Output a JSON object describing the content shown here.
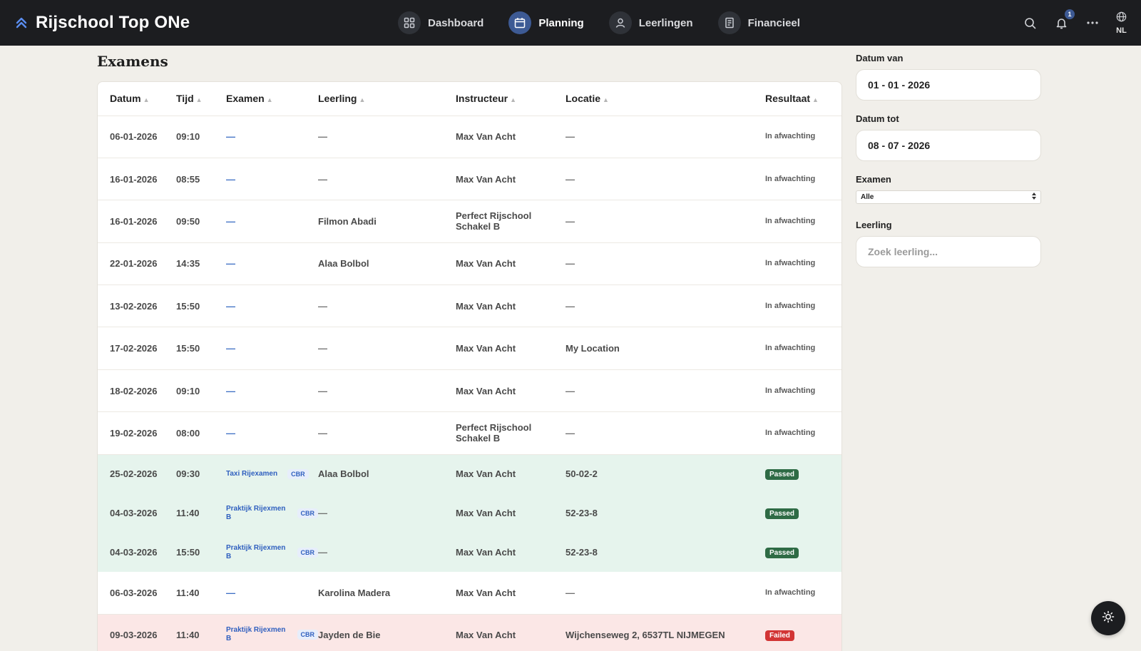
{
  "app": {
    "title": "Rijschool Top ONe",
    "logo_icon": "double-chevron-up-icon"
  },
  "nav": [
    {
      "label": "Dashboard",
      "icon": "grid-icon",
      "active": false
    },
    {
      "label": "Planning",
      "icon": "calendar-icon",
      "active": true
    },
    {
      "label": "Leerlingen",
      "icon": "user-icon",
      "active": false
    },
    {
      "label": "Financieel",
      "icon": "document-icon",
      "active": false
    }
  ],
  "topbar": {
    "notification_count": "1",
    "language": "NL"
  },
  "page": {
    "title": "Examens"
  },
  "table": {
    "headers": [
      "Datum",
      "Tijd",
      "Examen",
      "Leerling",
      "Instructeur",
      "Locatie",
      "Resultaat"
    ],
    "rows": [
      {
        "datum": "06-01-2026",
        "tijd": "09:10",
        "examen": "—",
        "leerling": "—",
        "instructeur": "Max Van Acht",
        "locatie": "—",
        "resultaat": "In afwachting",
        "status": "pending"
      },
      {
        "datum": "16-01-2026",
        "tijd": "08:55",
        "examen": "—",
        "leerling": "—",
        "instructeur": "Max Van Acht",
        "locatie": "—",
        "resultaat": "In afwachting",
        "status": "pending"
      },
      {
        "datum": "16-01-2026",
        "tijd": "09:50",
        "examen": "—",
        "leerling": "Filmon Abadi",
        "instructeur": "Perfect Rijschool Schakel B",
        "locatie": "—",
        "resultaat": "In afwachting",
        "status": "pending"
      },
      {
        "datum": "22-01-2026",
        "tijd": "14:35",
        "examen": "—",
        "leerling": "Alaa Bolbol",
        "instructeur": "Max Van Acht",
        "locatie": "—",
        "resultaat": "In afwachting",
        "status": "pending"
      },
      {
        "datum": "13-02-2026",
        "tijd": "15:50",
        "examen": "—",
        "leerling": "—",
        "instructeur": "Max Van Acht",
        "locatie": "—",
        "resultaat": "In afwachting",
        "status": "pending"
      },
      {
        "datum": "17-02-2026",
        "tijd": "15:50",
        "examen": "—",
        "leerling": "—",
        "instructeur": "Max Van Acht",
        "locatie": "My Location",
        "resultaat": "In afwachting",
        "status": "pending"
      },
      {
        "datum": "18-02-2026",
        "tijd": "09:10",
        "examen": "—",
        "leerling": "—",
        "instructeur": "Max Van Acht",
        "locatie": "—",
        "resultaat": "In afwachting",
        "status": "pending"
      },
      {
        "datum": "19-02-2026",
        "tijd": "08:00",
        "examen": "—",
        "leerling": "—",
        "instructeur": "Perfect Rijschool Schakel B",
        "locatie": "—",
        "resultaat": "In afwachting",
        "status": "pending"
      },
      {
        "datum": "25-02-2026",
        "tijd": "09:30",
        "examen": "Taxi Rijexamen",
        "badge": "CBR",
        "leerling": "Alaa Bolbol",
        "instructeur": "Max Van Acht",
        "locatie": "50-02-2",
        "resultaat": "Passed",
        "status": "passed"
      },
      {
        "datum": "04-03-2026",
        "tijd": "11:40",
        "examen": "Praktijk Rijexmen B",
        "badge": "CBR",
        "leerling": "—",
        "instructeur": "Max Van Acht",
        "locatie": "52-23-8",
        "resultaat": "Passed",
        "status": "passed"
      },
      {
        "datum": "04-03-2026",
        "tijd": "15:50",
        "examen": "Praktijk Rijexmen B",
        "badge": "CBR",
        "leerling": "—",
        "instructeur": "Max Van Acht",
        "locatie": "52-23-8",
        "resultaat": "Passed",
        "status": "passed"
      },
      {
        "datum": "06-03-2026",
        "tijd": "11:40",
        "examen": "—",
        "leerling": "Karolina Madera",
        "instructeur": "Max Van Acht",
        "locatie": "—",
        "resultaat": "In afwachting",
        "status": "pending"
      },
      {
        "datum": "09-03-2026",
        "tijd": "11:40",
        "examen": "Praktijk Rijexmen B",
        "badge": "CBR",
        "leerling": "Jayden de Bie",
        "instructeur": "Max Van Acht",
        "locatie": "Wijchenseweg 2, 6537TL NIJMEGEN",
        "resultaat": "Failed",
        "status": "failed"
      }
    ]
  },
  "filters": {
    "datum_van_label": "Datum van",
    "datum_van_value": "01 - 01 - 2026",
    "datum_tot_label": "Datum tot",
    "datum_tot_value": "08 - 07 - 2026",
    "examen_label": "Examen",
    "examen_value": "Alle",
    "leerling_label": "Leerling",
    "leerling_placeholder": "Zoek leerling..."
  },
  "colors": {
    "topbar_bg": "#1c1d20",
    "accent": "#3d5a94",
    "passed_row": "#e6f4ed",
    "failed_row": "#fbe7e6",
    "passed_pill": "#2e6b45",
    "failed_pill": "#d23535",
    "page_bg": "#f1efea"
  }
}
